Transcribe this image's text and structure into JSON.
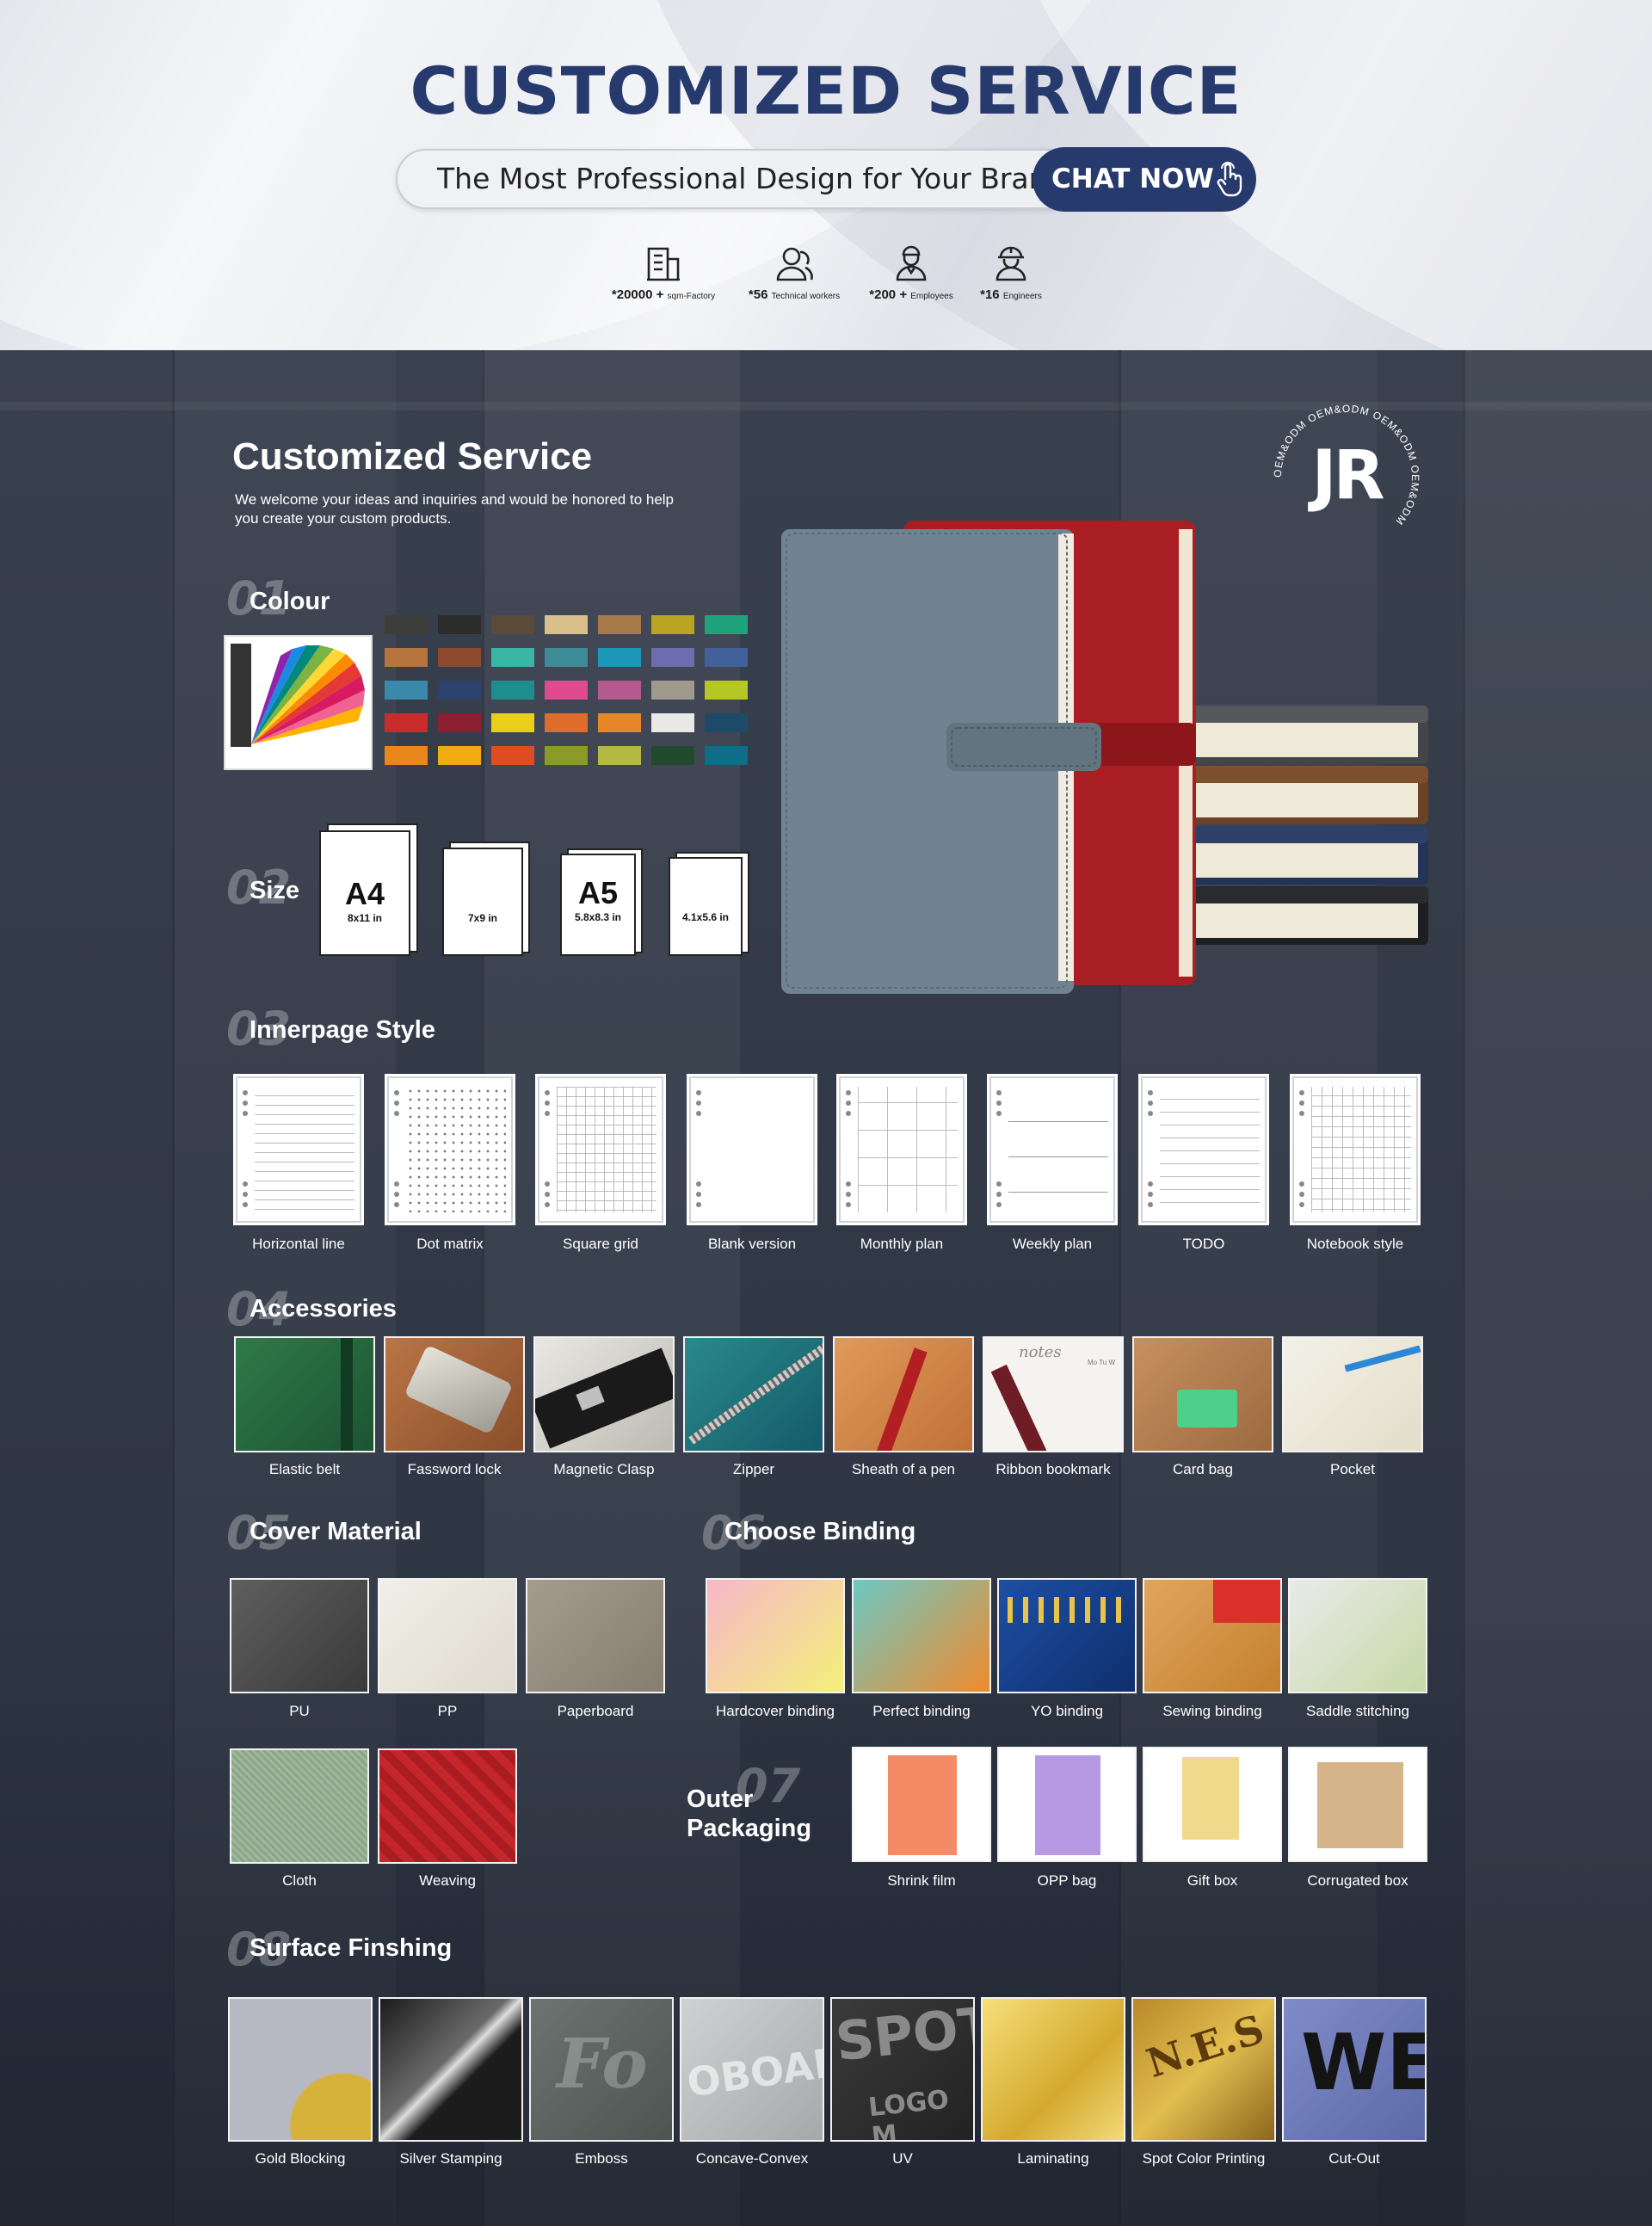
{
  "hero": {
    "title": "CUSTOMIZED SERVICE",
    "slogan": "The Most Professional Design for Your Brand",
    "chat_label": "CHAT NOW",
    "stats": [
      {
        "value": "*20000 +",
        "unit": "sqm-Factory",
        "icon": "factory-icon"
      },
      {
        "value": "*56",
        "unit": "Technical workers",
        "icon": "worker-icon"
      },
      {
        "value": "*200 +",
        "unit": "Employees",
        "icon": "employee-icon"
      },
      {
        "value": "*16",
        "unit": "Engineers",
        "icon": "engineer-icon"
      }
    ]
  },
  "main": {
    "title": "Customized Service",
    "description": "We welcome your ideas and inquiries and would be honored to help you create your custom products.",
    "badge": {
      "text": "JR",
      "ring": "OEM&ODM OEM&ODM OEM&ODM OEM&ODM"
    }
  },
  "colour": {
    "num": "01",
    "title": "Colour",
    "swatches": [
      "#3d3d3a",
      "#2c2c2a",
      "#5a4a3a",
      "#d9c08a",
      "#a5794a",
      "#b9a523",
      "#1fa37a",
      "#b8743d",
      "#8b4a2e",
      "#3cb6a4",
      "#3f8c99",
      "#1e98b8",
      "#6c6db0",
      "#42619a",
      "#3a88ab",
      "#2b416e",
      "#1d8e8e",
      "#e04b8f",
      "#b45a8f",
      "#9e9a8d",
      "#b5c722",
      "#c92b2b",
      "#8c1f32",
      "#e8d01a",
      "#e06c2b",
      "#e8862a",
      "#e8e8e6",
      "#1e4a6a",
      "#e8871c",
      "#f1ac12",
      "#e04c22",
      "#8a9b2a",
      "#b4b944",
      "#1f4a2b",
      "#0e6e8a"
    ]
  },
  "size": {
    "num": "02",
    "title": "Size",
    "cards": [
      {
        "big": "A4",
        "small": "8x11 in"
      },
      {
        "big": "",
        "small": "7x9 in"
      },
      {
        "big": "A5",
        "small": "5.8x8.3 in"
      },
      {
        "big": "",
        "small": "4.1x5.6 in"
      }
    ]
  },
  "innerpage": {
    "num": "03",
    "title": "Innerpage Style",
    "items": [
      "Horizontal line",
      "Dot matrix",
      "Square grid",
      "Blank version",
      "Monthly plan",
      "Weekly plan",
      "TODO",
      "Notebook style"
    ]
  },
  "accessories": {
    "num": "04",
    "title": "Accessories",
    "items": [
      "Elastic belt",
      "Fassword lock",
      "Magnetic Clasp",
      "Zipper",
      "Sheath of a pen",
      "Ribbon bookmark",
      "Card bag",
      "Pocket"
    ],
    "notes_text": "notes",
    "ribbon_days": "Mo  Tu  W"
  },
  "cover": {
    "num": "05",
    "title": "Cover Material",
    "items": [
      "PU",
      "PP",
      "Paperboard",
      "Cloth",
      "Weaving"
    ]
  },
  "binding": {
    "num": "06",
    "title": "Choose Binding",
    "items": [
      "Hardcover binding",
      "Perfect binding",
      "YO binding",
      "Sewing binding",
      "Saddle stitching"
    ]
  },
  "packaging": {
    "num": "07",
    "title_line1": "Outer",
    "title_line2": "Packaging",
    "items": [
      "Shrink film",
      "OPP bag",
      "Gift box",
      "Corrugated box"
    ]
  },
  "surface": {
    "num": "08",
    "title": "Surface Finshing",
    "items": [
      "Gold Blocking",
      "Silver Stamping",
      "Emboss",
      "Concave-Convex",
      "UV",
      "Laminating",
      "Spot Color Printing",
      "Cut-Out"
    ],
    "sample_text": {
      "emboss": "Fo",
      "concave": "OBOAR",
      "uv_top": "SPOT",
      "uv_bottom": "LOGO M",
      "spot": "N.E.S",
      "cutout": "WE"
    }
  }
}
